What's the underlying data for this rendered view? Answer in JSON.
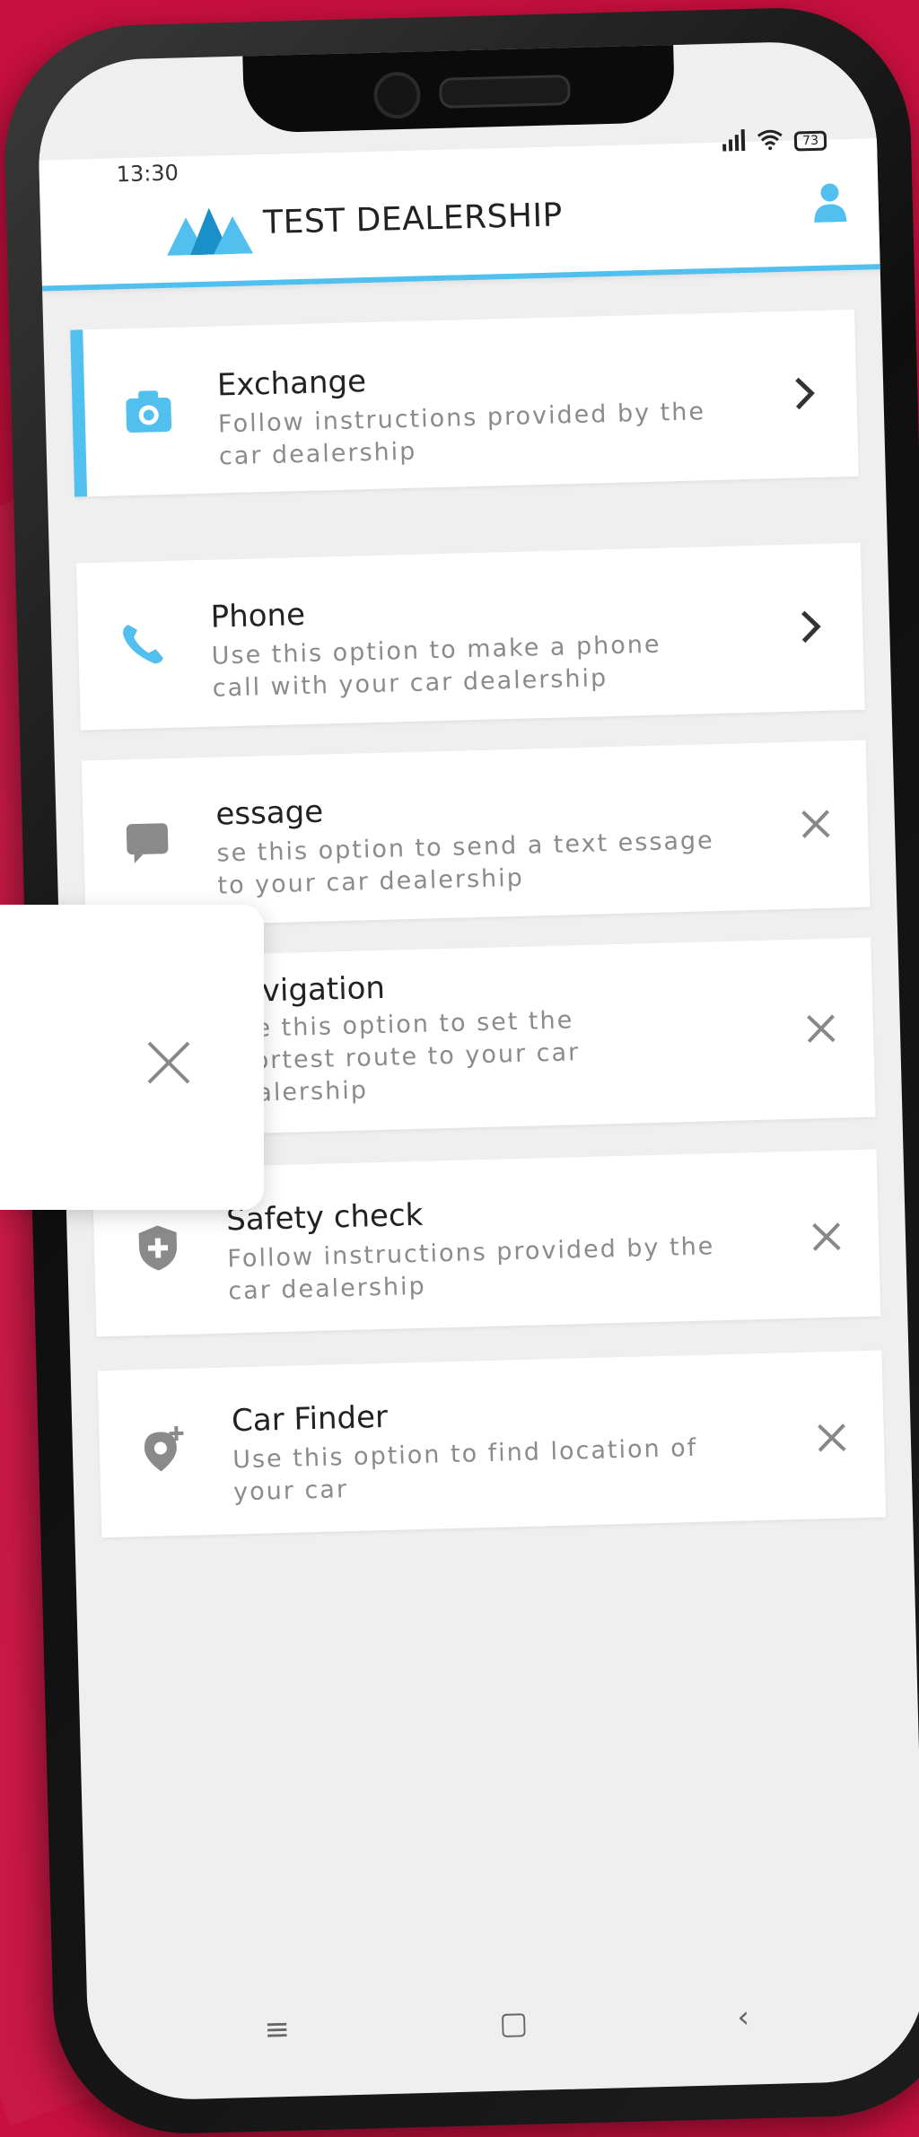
{
  "status_bar": {
    "time": "13:30",
    "battery": "73"
  },
  "header": {
    "title": "TEST DEALERSHIP"
  },
  "cards": [
    {
      "title": "Exchange",
      "description": "Follow instructions provided by the car dealership",
      "icon": "camera-icon",
      "action": "chevron-right-icon"
    },
    {
      "title": "Phone",
      "description": "Use this option to make a phone call with your car dealership",
      "icon": "phone-icon",
      "action": "chevron-right-icon"
    },
    {
      "title": "essage",
      "description": "se this option to send a text essage to your car dealership",
      "icon": "message-icon",
      "action": "close-icon"
    },
    {
      "title": "Navigation",
      "description": "Use this option to set the shortest route to your car dealership",
      "icon": "navigation-icon",
      "action": "close-icon"
    },
    {
      "title": "Safety check",
      "description": "Follow instructions provided by the car dealership",
      "icon": "shield-icon",
      "action": "close-icon"
    },
    {
      "title": "Car Finder",
      "description": "Use this option to find location of your car",
      "icon": "location-add-icon",
      "action": "close-icon"
    }
  ],
  "nav": {
    "menu": "≡",
    "home": "▢",
    "back": "‹"
  },
  "colors": {
    "accent": "#52c0ee",
    "background": "#c8103e"
  }
}
